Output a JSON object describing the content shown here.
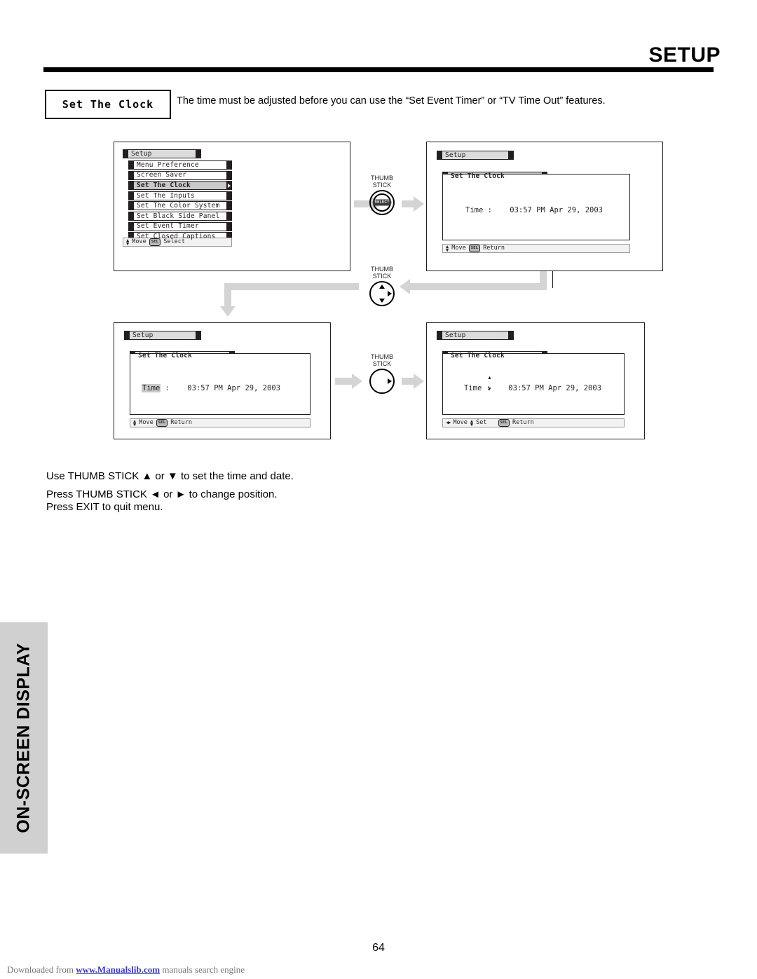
{
  "header": {
    "title": "SETUP"
  },
  "section": {
    "label": "Set The Clock",
    "intro": "The time must be adjusted before you can use the “Set Event Timer” or “TV Time Out” features."
  },
  "panels": {
    "panel1": {
      "title": "Setup",
      "items": [
        {
          "label": "Menu Preference",
          "selected": false
        },
        {
          "label": "Screen Saver",
          "selected": false
        },
        {
          "label": "Set The Clock",
          "selected": true
        },
        {
          "label": "Set The Inputs",
          "selected": false
        },
        {
          "label": "Set The Color System",
          "selected": false
        },
        {
          "label": "Set Black Side Panel",
          "selected": false
        },
        {
          "label": "Set Event Timer",
          "selected": false
        },
        {
          "label": "Set Closed Captions",
          "selected": false
        }
      ],
      "footer": {
        "move": "Move",
        "sel_key": "SEL",
        "action": "Select"
      }
    },
    "panel2": {
      "title": "Setup",
      "submenu": "Set The Clock",
      "time_label": "Time :",
      "time_value": "03:57 PM Apr 29, 2003",
      "footer": {
        "move": "Move",
        "sel_key": "SEL",
        "action": "Return"
      }
    },
    "panel3": {
      "title": "Setup",
      "submenu": "Set The Clock",
      "time_label": "Time",
      "time_colon": ":",
      "time_value": "03:57 PM Apr 29, 2003",
      "footer": {
        "move": "Move",
        "sel_key": "SEL",
        "action": "Return"
      }
    },
    "panel4": {
      "title": "Setup",
      "submenu": "Set The Clock",
      "time_label": "Time :",
      "time_value": "03:57 PM Apr 29, 2003",
      "spin_up": "▲",
      "spin_down": "▼",
      "footer": {
        "move": "Move",
        "set": "Set",
        "sel_key": "SEL",
        "action": "Return"
      }
    }
  },
  "thumbsticks": {
    "ts1": {
      "line1": "THUMB",
      "line2": "STICK",
      "cap": "SELECT"
    },
    "ts2": {
      "line1": "THUMB",
      "line2": "STICK"
    },
    "ts3": {
      "line1": "THUMB",
      "line2": "STICK"
    }
  },
  "instructions": {
    "line1": "Use THUMB STICK ▲ or ▼ to set the time and date.",
    "line2": "Press THUMB STICK ◄ or ► to change position.",
    "line3": "Press EXIT to quit menu."
  },
  "side_tab": {
    "label": "ON-SCREEN DISPLAY"
  },
  "footer": {
    "page_number": "64",
    "download_prefix": "Downloaded from ",
    "download_link": "www.Manualslib.com",
    "download_suffix": " manuals search engine"
  },
  "colors": {
    "flow_arrow": "#d4d4d4",
    "side_tab_bg": "#d0d0d0",
    "osd_ink": "#231f20",
    "link": "#3a3ad0"
  }
}
